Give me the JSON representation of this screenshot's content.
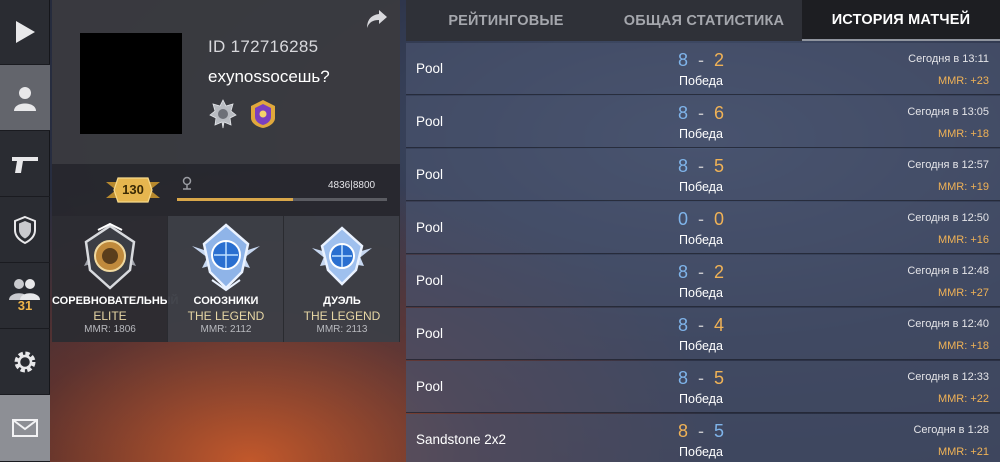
{
  "profile": {
    "id_text": "ID 172716285",
    "name": "exynossocешь?",
    "level": "130",
    "xp_text": "4836|8800",
    "xp_progress": 0.55
  },
  "nav": {
    "friends_count": "31"
  },
  "ranks": [
    {
      "mode": "СОРЕВНОВАТЕЛЬНЫЙ",
      "rank": "ELITE",
      "mmr": "MMR: 1806"
    },
    {
      "mode": "СОЮЗНИКИ",
      "rank": "THE LEGEND",
      "mmr": "MMR: 2112"
    },
    {
      "mode": "ДУЭЛЬ",
      "rank": "THE LEGEND",
      "mmr": "MMR: 2113"
    }
  ],
  "tabs": [
    {
      "label": "РЕЙТИНГОВЫЕ"
    },
    {
      "label": "ОБЩАЯ СТАТИСТИКА"
    },
    {
      "label": "ИСТОРИЯ МАТЧЕЙ"
    }
  ],
  "matches": [
    {
      "map": "Pool",
      "score_a": "8",
      "sep": "-",
      "score_b": "2",
      "result": "Победа",
      "time": "Сегодня в 13:11",
      "mmr": "MMR: +23"
    },
    {
      "map": "Pool",
      "score_a": "8",
      "sep": "-",
      "score_b": "6",
      "result": "Победа",
      "time": "Сегодня в 13:05",
      "mmr": "MMR: +18"
    },
    {
      "map": "Pool",
      "score_a": "8",
      "sep": "-",
      "score_b": "5",
      "result": "Победа",
      "time": "Сегодня в 12:57",
      "mmr": "MMR: +19"
    },
    {
      "map": "Pool",
      "score_a": "0",
      "sep": "-",
      "score_b": "0",
      "result": "Победа",
      "time": "Сегодня в 12:50",
      "mmr": "MMR: +16"
    },
    {
      "map": "Pool",
      "score_a": "8",
      "sep": "-",
      "score_b": "2",
      "result": "Победа",
      "time": "Сегодня в 12:48",
      "mmr": "MMR: +27"
    },
    {
      "map": "Pool",
      "score_a": "8",
      "sep": "-",
      "score_b": "4",
      "result": "Победа",
      "time": "Сегодня в 12:40",
      "mmr": "MMR: +18"
    },
    {
      "map": "Pool",
      "score_a": "8",
      "sep": "-",
      "score_b": "5",
      "result": "Победа",
      "time": "Сегодня в 12:33",
      "mmr": "MMR: +22"
    },
    {
      "map": "Sandstone 2x2",
      "score_a": "8",
      "sep": "-",
      "score_b": "5",
      "result": "Победа",
      "time": "Сегодня в 1:28",
      "mmr": "MMR: +21"
    }
  ],
  "icons": {
    "nav": [
      "play-icon",
      "profile-icon",
      "weapon-icon",
      "clan-shield-icon",
      "friends-icon",
      "gear-icon",
      "mail-icon"
    ],
    "share": "share-arrow-icon"
  },
  "colors": {
    "team_a": "#7fb4ea",
    "team_b": "#f0b256",
    "mmr_gain": "#f0b256",
    "accent_gold": "#d9a74a"
  }
}
